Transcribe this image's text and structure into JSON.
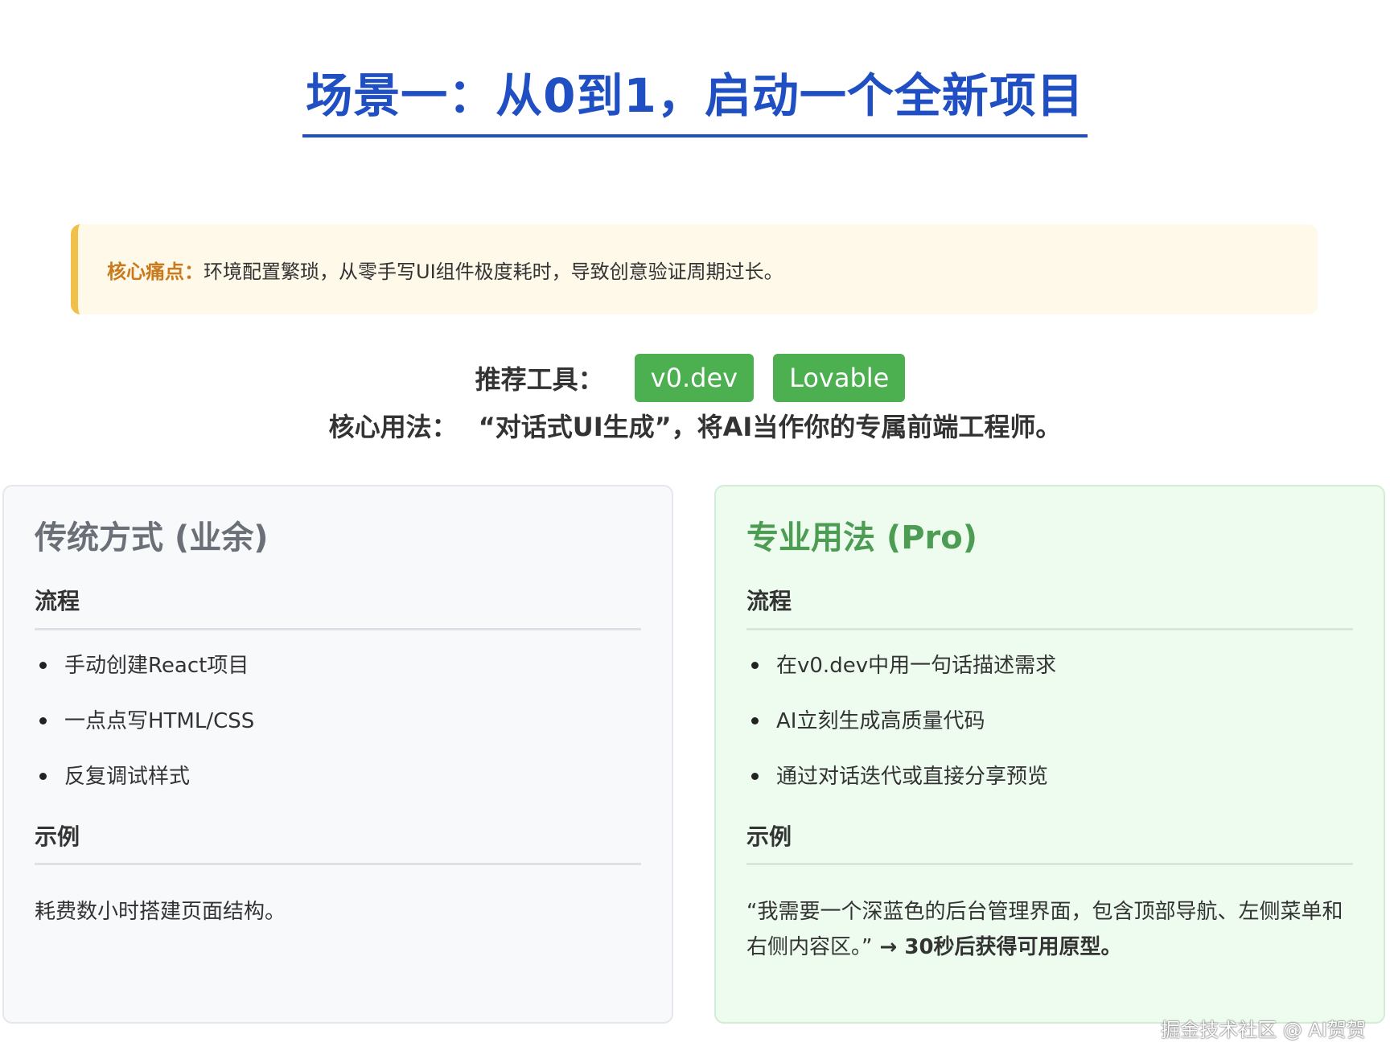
{
  "title": "场景一：从0到1，启动一个全新项目",
  "pain_point": {
    "label": "核心痛点：",
    "text": "环境配置繁琐，从零手写UI组件极度耗时，导致创意验证周期过长。"
  },
  "tools": {
    "label": "推荐工具：",
    "items": [
      "v0.dev",
      "Lovable"
    ]
  },
  "usage": {
    "label": "核心用法：",
    "text": "“对话式UI生成”，将AI当作你的专属前端工程师。"
  },
  "left_card": {
    "title": "传统方式 (业余)",
    "process_heading": "流程",
    "steps": [
      "手动创建React项目",
      "一点点写HTML/CSS",
      "反复调试样式"
    ],
    "example_heading": "示例",
    "example_text": "耗费数小时搭建页面结构。"
  },
  "right_card": {
    "title": "专业用法 (Pro)",
    "process_heading": "流程",
    "steps": [
      "在v0.dev中用一句话描述需求",
      "AI立刻生成高质量代码",
      "通过对话迭代或直接分享预览"
    ],
    "example_heading": "示例",
    "example_quote": "“我需要一个深蓝色的后台管理界面，包含顶部导航、左侧菜单和右侧内容区。”",
    "example_result": " → 30秒后获得可用原型。"
  },
  "watermark": "掘金技术社区 @ AI贺贺",
  "colors": {
    "title_blue": "#1f4fc2",
    "pain_accent": "#f0c04a",
    "badge_green": "#4caf50",
    "pro_title_green": "#4c9c54"
  }
}
